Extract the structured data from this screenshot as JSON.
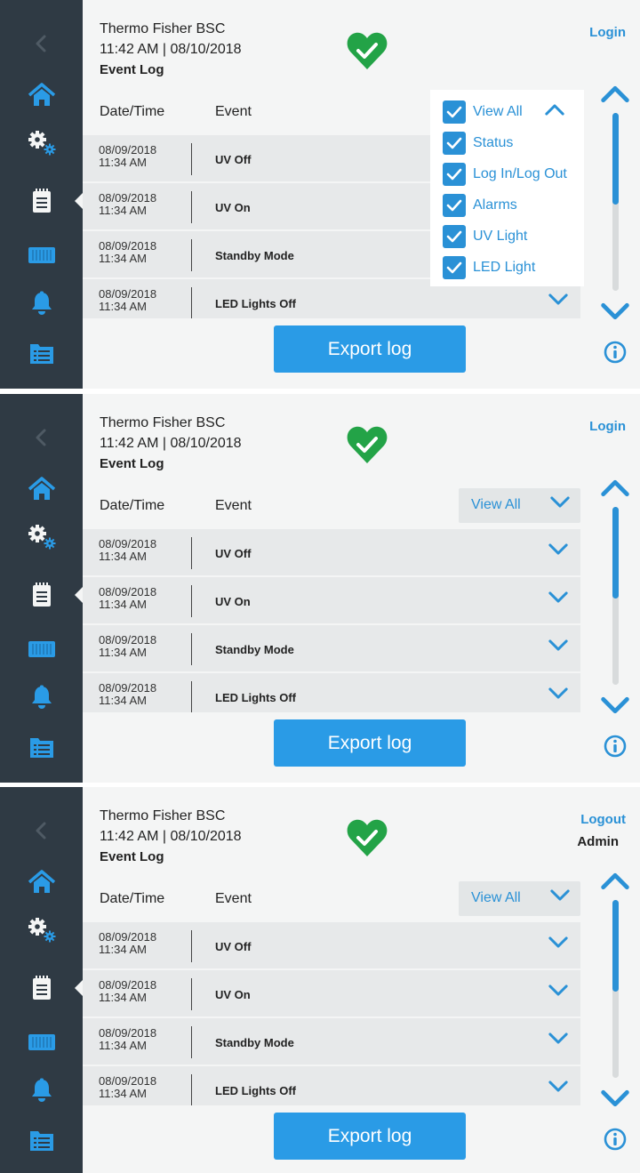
{
  "colors": {
    "accent": "#2a91d6",
    "sidebar": "#2f3a44",
    "status_ok": "#23a347",
    "button": "#2a9be6"
  },
  "header": {
    "company": "Thermo Fisher BSC",
    "datetime": "11:42  AM | 08/10/2018",
    "page_title": "Event Log"
  },
  "sidebar": {
    "items": [
      {
        "icon": "back-arrow-icon"
      },
      {
        "icon": "home-icon"
      },
      {
        "icon": "settings-gears-icon"
      },
      {
        "icon": "clipboard-icon"
      },
      {
        "icon": "filter-cassette-icon"
      },
      {
        "icon": "bell-icon"
      },
      {
        "icon": "calendar-list-icon"
      }
    ],
    "active": "clipboard-icon"
  },
  "table": {
    "headers": {
      "date": "Date/Time",
      "event": "Event"
    },
    "filter_label": "View All",
    "rows": [
      {
        "date": "08/09/2018",
        "time": "11:34  AM",
        "event": "UV Off"
      },
      {
        "date": "08/09/2018",
        "time": "11:34  AM",
        "event": "UV On"
      },
      {
        "date": "08/09/2018",
        "time": "11:34  AM",
        "event": "Standby Mode"
      },
      {
        "date": "08/09/2018",
        "time": "11:34  AM",
        "event": "LED Lights Off"
      }
    ]
  },
  "filter_dropdown": {
    "options": [
      {
        "label": "View All",
        "checked": true
      },
      {
        "label": "Status",
        "checked": true
      },
      {
        "label": "Log In/Log Out",
        "checked": true
      },
      {
        "label": "Alarms",
        "checked": true
      },
      {
        "label": "UV Light",
        "checked": true
      },
      {
        "label": "LED Light",
        "checked": true
      }
    ]
  },
  "export_label": "Export log",
  "screens": [
    {
      "auth_label": "Login",
      "user": "",
      "dropdown_open": true
    },
    {
      "auth_label": "Login",
      "user": "",
      "dropdown_open": false
    },
    {
      "auth_label": "Logout",
      "user": "Admin",
      "dropdown_open": false
    }
  ]
}
